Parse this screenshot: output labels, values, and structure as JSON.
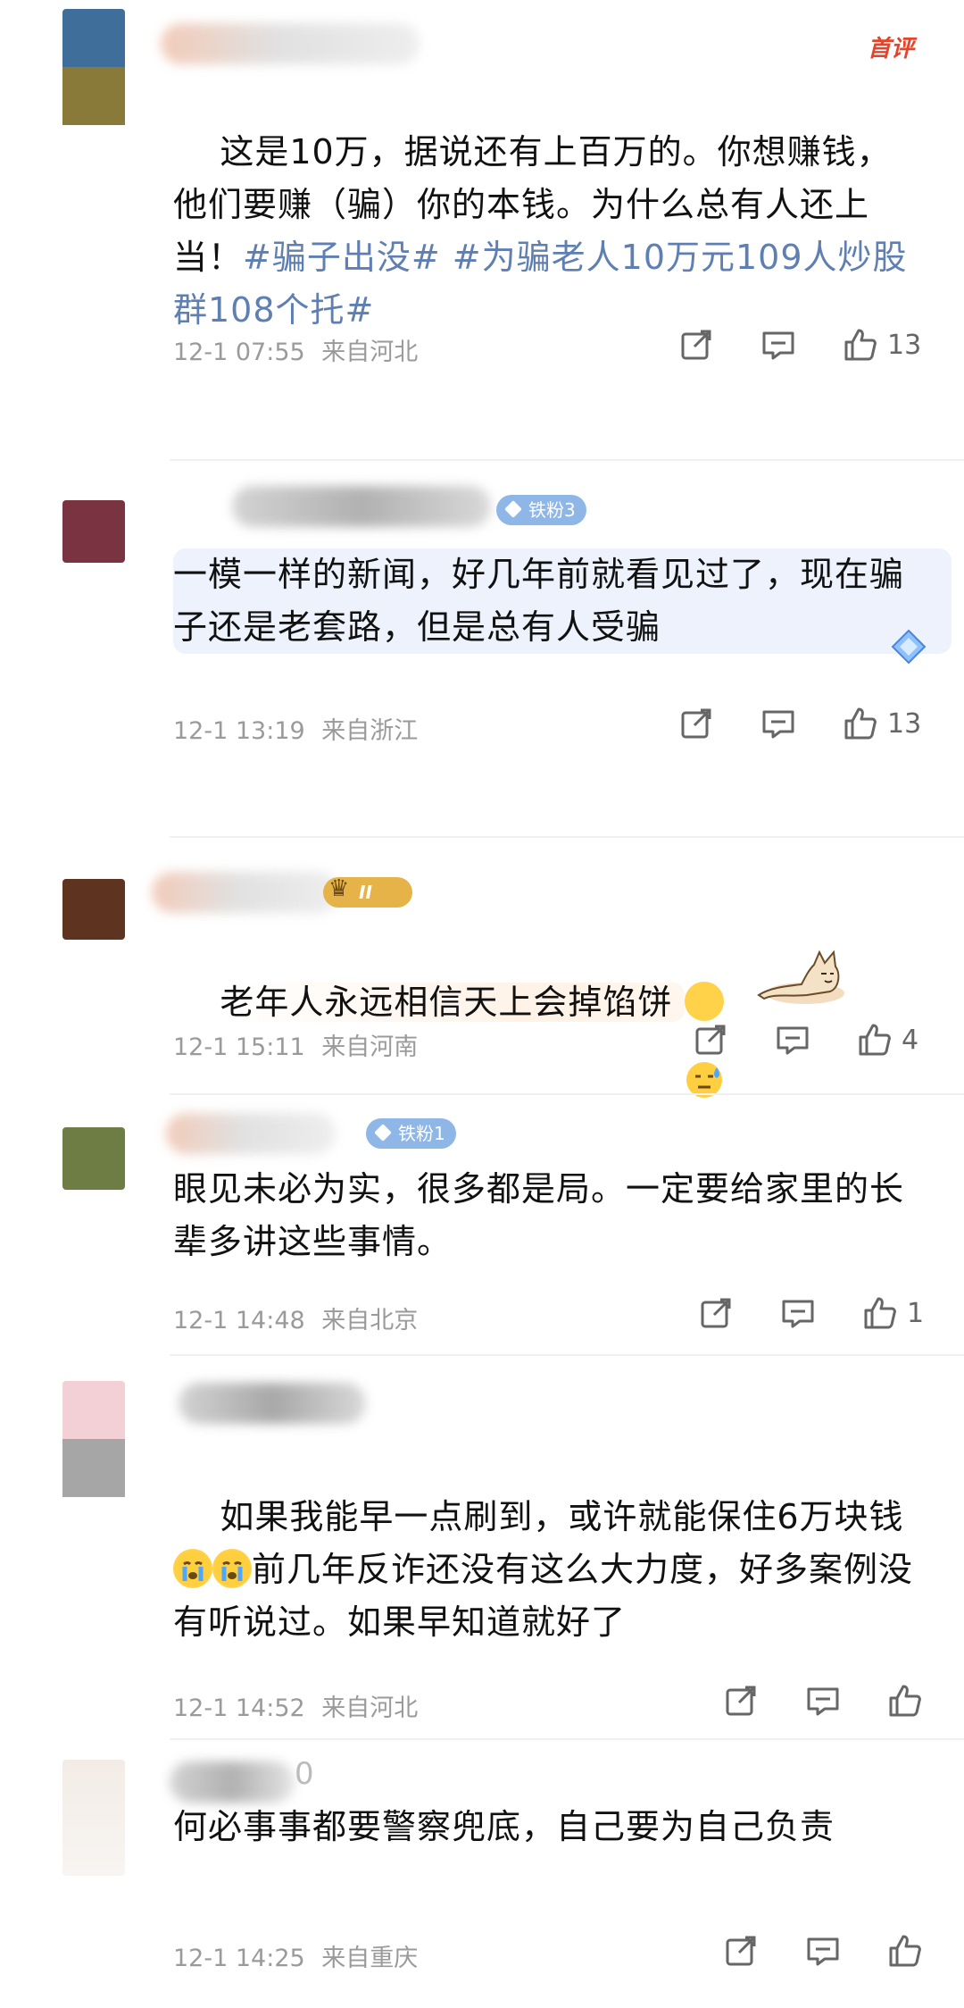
{
  "comments": [
    {
      "top_tag": "首评",
      "text_parts": [
        {
          "t": "这是10万，据说还有上百万的。你想赚钱，他们要赚（骗）你的本钱。为什么总有人还上当！"
        },
        {
          "t": "#骗子出没#",
          "tag": true
        },
        {
          "t": " "
        },
        {
          "t": "#为骗老人10万元109人炒股群108个托#",
          "tag": true
        }
      ],
      "time": "12-1 07:55",
      "location": "来自河北",
      "likes": "13",
      "avatar_colors": [
        "#3f6e9a",
        "#8a7a3a"
      ]
    },
    {
      "badge": "铁粉3",
      "text": "一模一样的新闻，好几年前就看见过了，现在骗子还是老套路，但是总有人受骗",
      "time": "12-1 13:19",
      "location": "来自浙江",
      "likes": "13",
      "avatar_colors": [
        "#7a3341"
      ]
    },
    {
      "badge": "II",
      "text": "老年人永远相信天上会掉馅饼",
      "time": "12-1 15:11",
      "location": "来自河南",
      "likes": "4",
      "avatar_colors": [
        "#5e3320"
      ]
    },
    {
      "badge": "铁粉1",
      "text": "眼见未必为实，很多都是局。一定要给家里的长辈多讲这些事情。",
      "time": "12-1 14:48",
      "location": "来自北京",
      "likes": "1",
      "avatar_colors": [
        "#6d7d44"
      ]
    },
    {
      "text_a": "如果我能早一点刷到，或许就能保住6万块钱",
      "text_b": "前几年反诈还没有这么大力度，好多案例没有听说过。如果早知道就好了",
      "time": "12-1 14:52",
      "location": "来自河北",
      "likes": "",
      "avatar_colors": [
        "#f2d0d6",
        "#a6a6a6"
      ]
    },
    {
      "name_fragment": "0",
      "text": "何必事事都要警察兜底，自己要为自己负责",
      "time": "12-1 14:25",
      "location": "来自重庆",
      "likes": "",
      "avatar_colors": [
        "#f3ece6"
      ]
    }
  ],
  "icons": {
    "share": "share-icon",
    "comment": "comment-icon",
    "like": "thumbs-up-icon",
    "crying_emoji": "crying-face-emoji",
    "sweat_emoji": "sweat-face-emoji"
  },
  "colors": {
    "topic_tag": "#5f7fb3",
    "top_tag": "#e2452c",
    "meta": "#9a9a9a"
  }
}
